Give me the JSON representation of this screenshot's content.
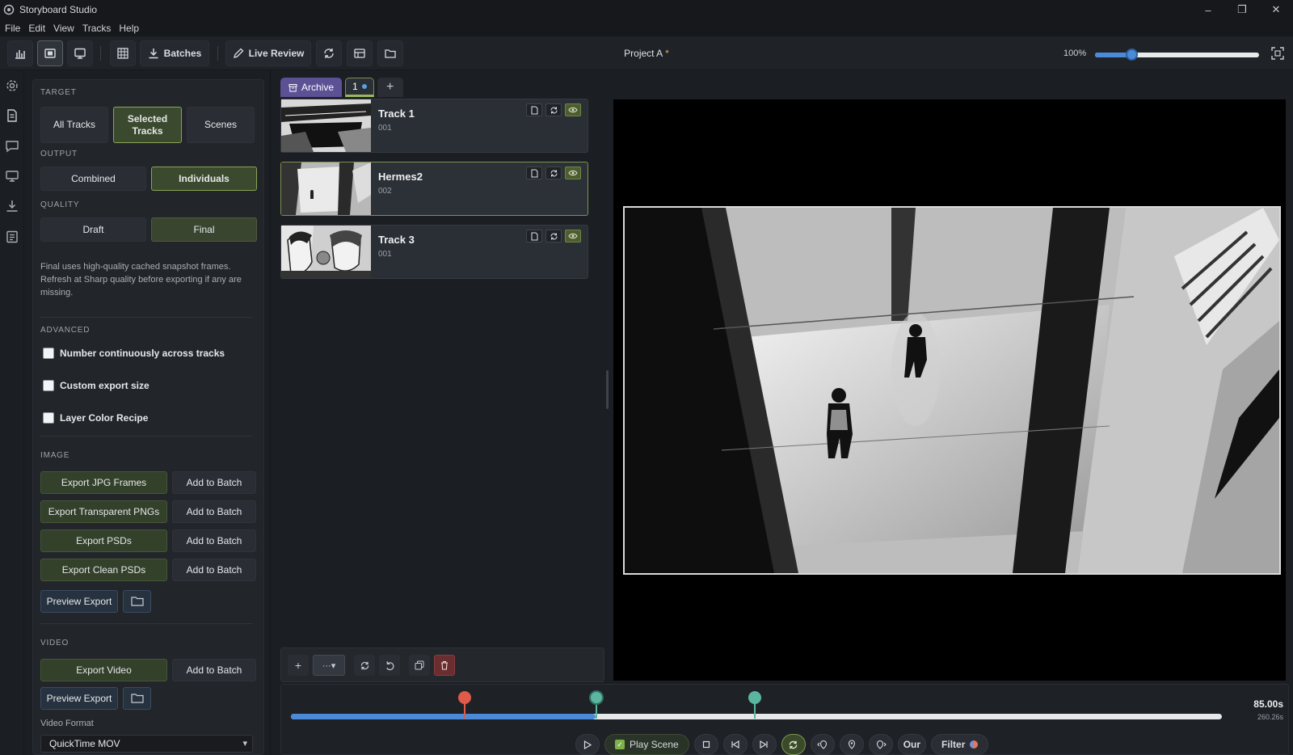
{
  "app": {
    "title": "Storyboard Studio"
  },
  "window_controls": {
    "minimize": "–",
    "restore": "❐",
    "close": "✕"
  },
  "menu": [
    "File",
    "Edit",
    "View",
    "Tracks",
    "Help"
  ],
  "toolbar": {
    "batches_label": "Batches",
    "live_review_label": "Live Review",
    "project_title": "Project A",
    "unsaved_marker": "*",
    "zoom_label": "100%",
    "zoom_level": 0.22
  },
  "left_panel": {
    "target": {
      "label": "TARGET",
      "options": [
        "All Tracks",
        "Selected Tracks",
        "Scenes"
      ],
      "selected": "Selected Tracks"
    },
    "output": {
      "label": "OUTPUT",
      "options": [
        "Combined",
        "Individuals"
      ],
      "selected": "Individuals"
    },
    "quality": {
      "label": "QUALITY",
      "options": [
        "Draft",
        "Final"
      ],
      "selected": "Final"
    },
    "quality_help": "Final uses high-quality cached snapshot frames. Refresh at Sharp quality before exporting if any are missing.",
    "advanced": {
      "label": "ADVANCED",
      "options": [
        {
          "label": "Number continuously across tracks",
          "checked": false
        },
        {
          "label": "Custom export size",
          "checked": false
        },
        {
          "label": "Layer Color Recipe",
          "checked": false
        }
      ]
    },
    "image": {
      "label": "IMAGE",
      "exports": [
        "Export JPG Frames",
        "Export Transparent PNGs",
        "Export PSDs",
        "Export Clean PSDs"
      ],
      "add_to_batch": "Add to Batch",
      "preview_export": "Preview Export"
    },
    "video": {
      "label": "VIDEO",
      "export_video": "Export Video",
      "add_to_batch": "Add to Batch",
      "preview_export": "Preview Export",
      "format_label": "Video Format",
      "format_value": "QuickTime MOV"
    }
  },
  "tabs": [
    {
      "label": "Archive"
    },
    {
      "label": "1"
    }
  ],
  "tracks": [
    {
      "name": "Track 1",
      "number": "001"
    },
    {
      "name": "Hermes2",
      "number": "002"
    },
    {
      "name": "Track 3",
      "number": "001"
    }
  ],
  "timeline": {
    "current_time": "85.00s",
    "total_time": "260.26s",
    "progress": 0.327,
    "markers": [
      {
        "position": 0.186,
        "color": "#e05a4a"
      },
      {
        "position": 0.327,
        "color": "#5bb5a0"
      },
      {
        "position": 0.497,
        "color": "#5bb5a0"
      }
    ]
  },
  "transport": {
    "play_scene_label": "Play Scene",
    "play_scene_checked": true,
    "our_label": "Our",
    "filter_label": "Filter"
  },
  "colors": {
    "accent_green": "#8aa455",
    "accent_blue": "#4a8ad8",
    "archive_tab": "#5c5195",
    "danger": "#6a2e30"
  }
}
